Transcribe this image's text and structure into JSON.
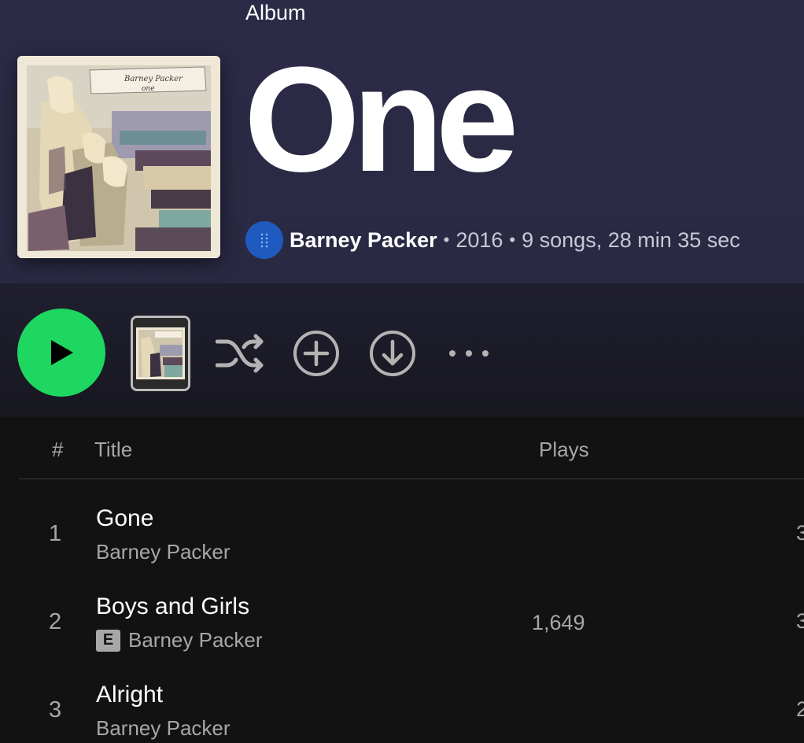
{
  "album": {
    "type_label": "Album",
    "title": "One",
    "artist": "Barney Packer",
    "year": "2016",
    "summary": "9 songs, 28 min 35 sec",
    "separator": "•",
    "cover_text_line1": "Barney Packer",
    "cover_text_line2": "one"
  },
  "controls": {
    "play_icon": "play-icon",
    "shuffle_icon": "shuffle-icon",
    "add_icon": "plus-circle-icon",
    "download_icon": "download-icon",
    "more_icon": "more-icon",
    "accent_color": "#1ed760"
  },
  "table": {
    "headers": {
      "number": "#",
      "title": "Title",
      "plays": "Plays"
    },
    "tracks": [
      {
        "number": "1",
        "title": "Gone",
        "artist": "Barney Packer",
        "explicit": false,
        "plays": "",
        "duration": "3"
      },
      {
        "number": "2",
        "title": "Boys and Girls",
        "artist": "Barney Packer",
        "explicit": true,
        "explicit_label": "E",
        "plays": "1,649",
        "duration": "3"
      },
      {
        "number": "3",
        "title": "Alright",
        "artist": "Barney Packer",
        "explicit": false,
        "plays": "",
        "duration": "2"
      }
    ]
  }
}
